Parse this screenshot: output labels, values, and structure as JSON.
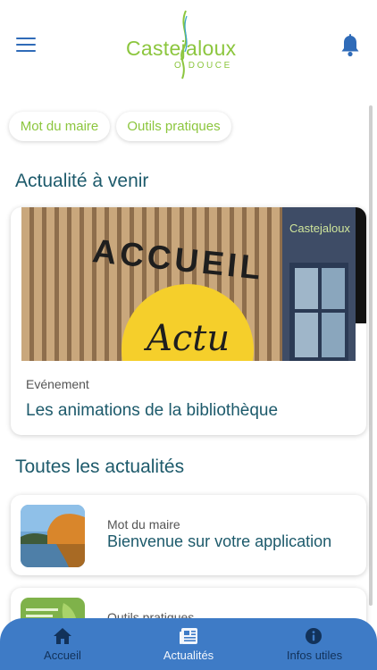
{
  "header": {
    "menu_icon": "hamburger-menu-icon",
    "logo_text": "Castejaloux",
    "logo_subtitle": "O DOUCE",
    "notification_icon": "bell-icon"
  },
  "chips": [
    {
      "label": "Mot du maire"
    },
    {
      "label": "Outils pratiques"
    }
  ],
  "upcoming": {
    "section_title": "Actualité à venir",
    "card": {
      "image_sign_text": "ACCUEIL",
      "image_badge_text": "Actu",
      "category": "Evénement",
      "title": "Les animations de la bibliothèque"
    }
  },
  "all_news": {
    "section_title": "Toutes les actualités",
    "items": [
      {
        "category": "Mot du maire",
        "title": "Bienvenue sur votre application"
      },
      {
        "category": "Outils pratiques",
        "title": ""
      }
    ]
  },
  "bottom_nav": {
    "items": [
      {
        "label": "Accueil",
        "icon": "home-icon"
      },
      {
        "label": "Actualités",
        "icon": "newspaper-icon"
      },
      {
        "label": "Infos utiles",
        "icon": "info-icon"
      }
    ]
  },
  "colors": {
    "brand_green": "#8cc63e",
    "title_teal": "#1d5a6b",
    "nav_blue": "#3e7bc6",
    "icon_blue": "#2f6bb8"
  }
}
